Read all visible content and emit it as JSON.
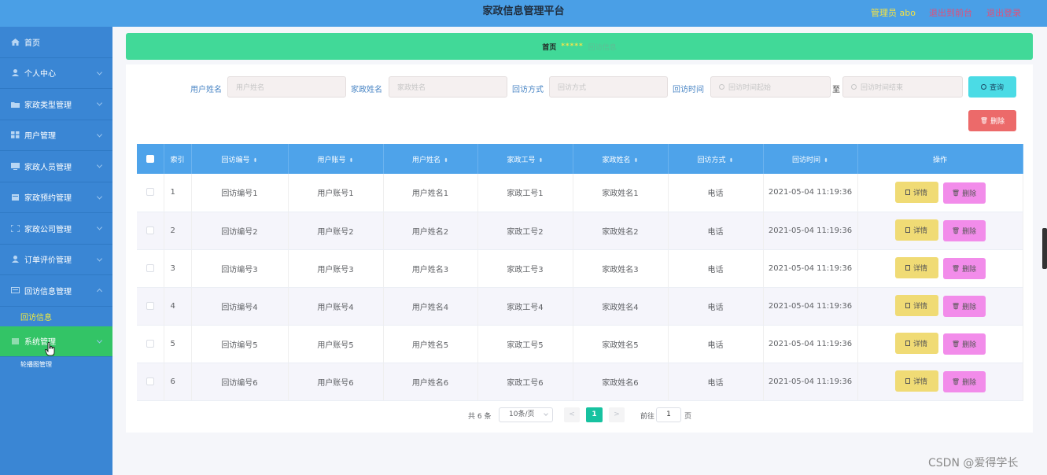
{
  "header": {
    "title": "家政信息管理平台",
    "admin_text": "管理员 abo",
    "back_front": "退出到前台",
    "logout": "退出登录"
  },
  "sidebar": {
    "items": [
      {
        "label": "首页",
        "icon": "home-icon"
      },
      {
        "label": "个人中心",
        "icon": "user-icon"
      },
      {
        "label": "家政类型管理",
        "icon": "folder-icon"
      },
      {
        "label": "用户管理",
        "icon": "grid-icon"
      },
      {
        "label": "家政人员管理",
        "icon": "monitor-icon"
      },
      {
        "label": "家政预约管理",
        "icon": "calendar-icon"
      },
      {
        "label": "家政公司管理",
        "icon": "frame-icon"
      },
      {
        "label": "订单评价管理",
        "icon": "person-icon"
      },
      {
        "label": "回访信息管理",
        "icon": "message-icon"
      }
    ],
    "sub_item": "回访信息",
    "system": "系统管理",
    "sub_cut": "轮播图管理"
  },
  "breadcrumb": {
    "home": "首页",
    "sep": "*****",
    "current": "回访信息"
  },
  "filters": {
    "user_name_label": "用户姓名",
    "user_name_ph": "用户姓名",
    "jz_name_label": "家政姓名",
    "jz_name_ph": "家政姓名",
    "method_label": "回访方式",
    "method_ph": "回访方式",
    "time_label": "回访时间",
    "time_start_ph": "回访时间起始",
    "to": "至",
    "time_end_ph": "回访时间结束",
    "search": "查询",
    "delete": "删除"
  },
  "table": {
    "headers": [
      "索引",
      "回访编号",
      "用户账号",
      "用户姓名",
      "家政工号",
      "家政姓名",
      "回访方式",
      "回访时间",
      "操作"
    ],
    "detail_label": "详情",
    "delete_label": "删除",
    "rows": [
      [
        "1",
        "回访编号1",
        "用户账号1",
        "用户姓名1",
        "家政工号1",
        "家政姓名1",
        "电话",
        "2021-05-04 11:19:36"
      ],
      [
        "2",
        "回访编号2",
        "用户账号2",
        "用户姓名2",
        "家政工号2",
        "家政姓名2",
        "电话",
        "2021-05-04 11:19:36"
      ],
      [
        "3",
        "回访编号3",
        "用户账号3",
        "用户姓名3",
        "家政工号3",
        "家政姓名3",
        "电话",
        "2021-05-04 11:19:36"
      ],
      [
        "4",
        "回访编号4",
        "用户账号4",
        "用户姓名4",
        "家政工号4",
        "家政姓名4",
        "电话",
        "2021-05-04 11:19:36"
      ],
      [
        "5",
        "回访编号5",
        "用户账号5",
        "用户姓名5",
        "家政工号5",
        "家政姓名5",
        "电话",
        "2021-05-04 11:19:36"
      ],
      [
        "6",
        "回访编号6",
        "用户账号6",
        "用户姓名6",
        "家政工号6",
        "家政姓名6",
        "电话",
        "2021-05-04 11:19:36"
      ]
    ]
  },
  "pager": {
    "total": "共 6 条",
    "page_size": "10条/页",
    "prev": "<",
    "current": "1",
    "next": ">",
    "goto": "前往",
    "goto_value": "1",
    "page_unit": "页"
  },
  "watermark": "CSDN @爱得学长"
}
